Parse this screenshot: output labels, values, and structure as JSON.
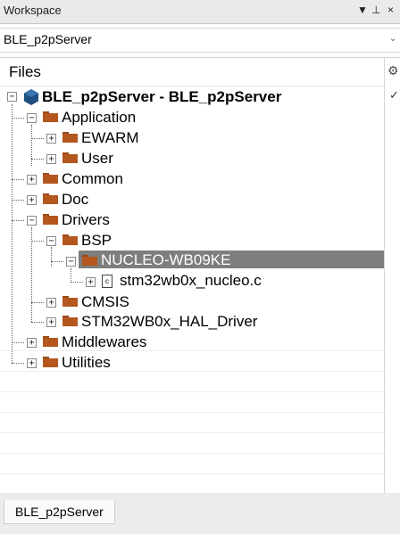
{
  "window": {
    "title": "Workspace",
    "dropdown_glyph": "▼",
    "pin_glyph": "⊥",
    "close_glyph": "×"
  },
  "config_select": {
    "value": "BLE_p2pServer",
    "arrow": "⌄"
  },
  "panel": {
    "header": "Files",
    "settings_icon": "gear-icon",
    "check_glyph": "✓"
  },
  "tree": {
    "root": "BLE_p2pServer - BLE_p2pServer",
    "nodes": [
      {
        "label": "Application",
        "expander": "−"
      },
      {
        "label": "EWARM",
        "expander": "+"
      },
      {
        "label": "User",
        "expander": "+"
      },
      {
        "label": "Common",
        "expander": "+"
      },
      {
        "label": "Doc",
        "expander": "+"
      },
      {
        "label": "Drivers",
        "expander": "−"
      },
      {
        "label": "BSP",
        "expander": "−"
      },
      {
        "label": "NUCLEO-WB09KE",
        "expander": "−",
        "selected": true
      },
      {
        "label": "stm32wb0x_nucleo.c",
        "expander": "+",
        "file_icon_text": "c"
      },
      {
        "label": "CMSIS",
        "expander": "+"
      },
      {
        "label": "STM32WB0x_HAL_Driver",
        "expander": "+"
      },
      {
        "label": "Middlewares",
        "expander": "+"
      },
      {
        "label": "Utilities",
        "expander": "+"
      }
    ]
  },
  "tabs": [
    {
      "label": "BLE_p2pServer",
      "active": true
    }
  ],
  "colors": {
    "folder": "#b3571f",
    "selection": "#7e7e7e",
    "project_icon": "#1f4f80"
  }
}
